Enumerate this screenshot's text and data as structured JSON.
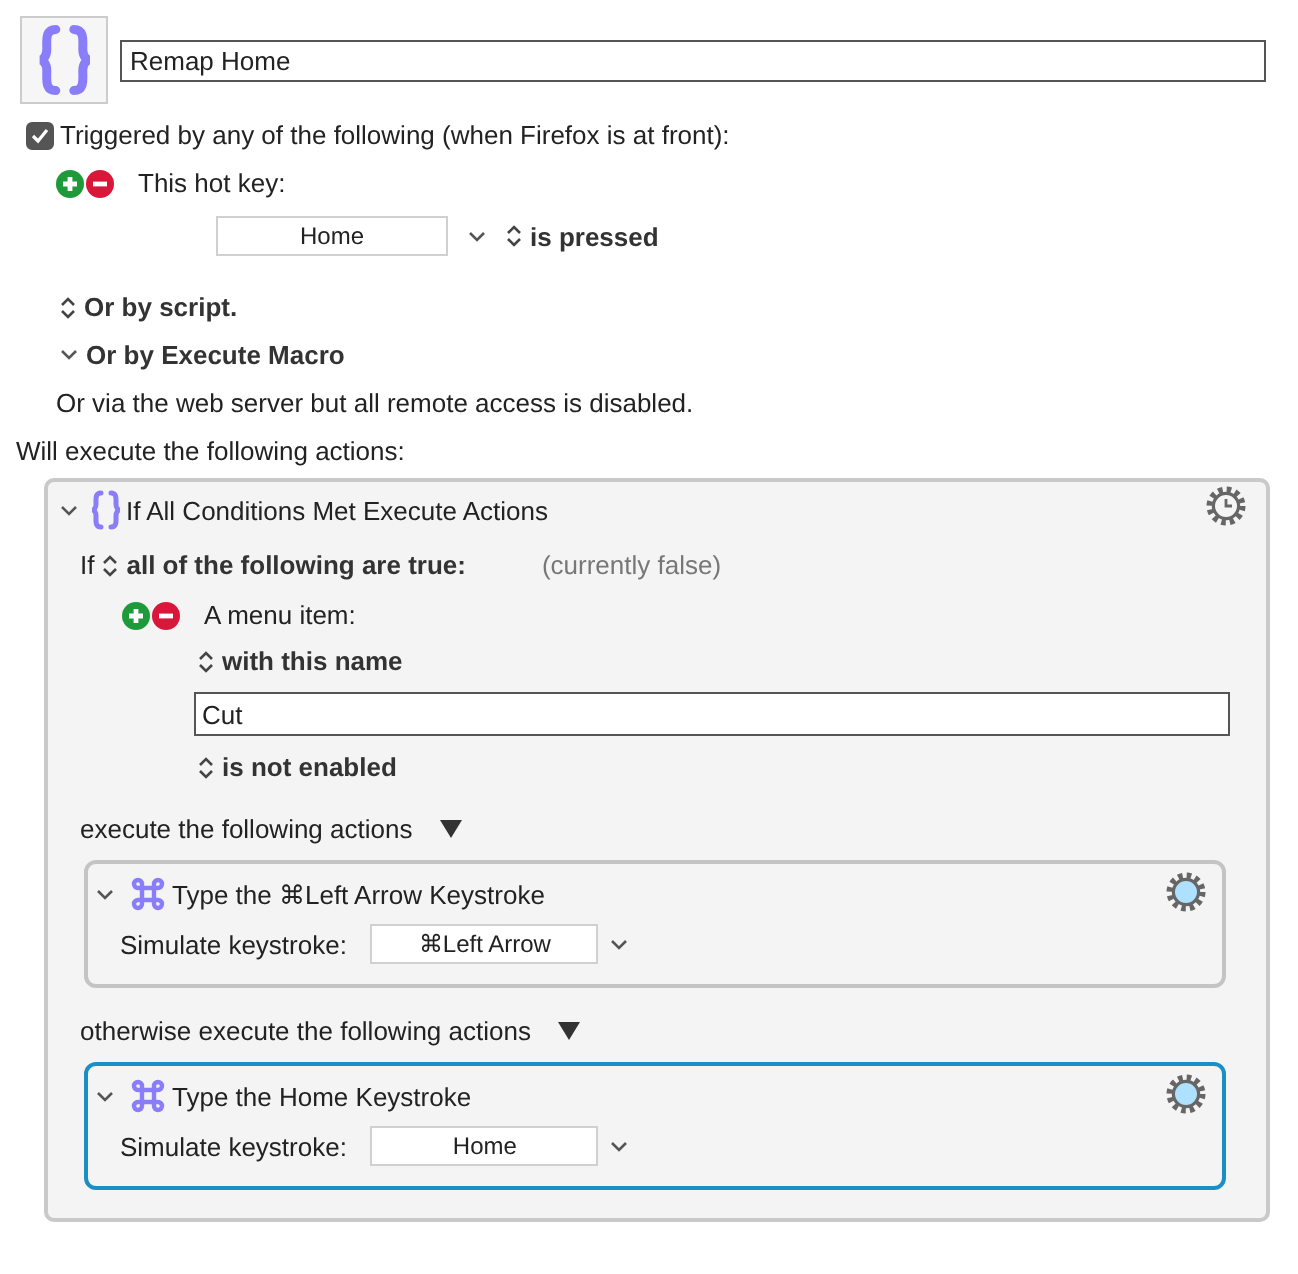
{
  "macro": {
    "name": "Remap Home"
  },
  "trigger": {
    "checked": true,
    "label": "Triggered by any of the following (when Firefox is at front):",
    "hotkey": {
      "label": "This hot key:",
      "key": "Home",
      "condition": "is pressed"
    },
    "alternatives": [
      {
        "kind": "stepper",
        "label": "Or by script."
      },
      {
        "kind": "disclosure",
        "label": "Or by Execute Macro"
      }
    ],
    "web_note": "Or via the web server but all remote access is disabled."
  },
  "actions_heading": "Will execute the following actions:",
  "group": {
    "title": "If All Conditions Met Execute Actions",
    "expanded": true,
    "if_label": "If",
    "match": "all of the following are true:",
    "status": "(currently false)",
    "condition": {
      "label": "A menu item:",
      "match": "with this name",
      "value": "Cut",
      "state": "is not enabled"
    },
    "then_label": "execute the following actions",
    "then_actions": [
      {
        "title": "Type the ⌘Left Arrow Keystroke",
        "expanded": true,
        "selected": false,
        "field_label": "Simulate keystroke:",
        "keystroke": "⌘Left Arrow"
      }
    ],
    "else_label": "otherwise execute the following actions",
    "else_actions": [
      {
        "title": "Type the Home Keystroke",
        "expanded": true,
        "selected": true,
        "field_label": "Simulate keystroke:",
        "keystroke": "Home"
      }
    ]
  }
}
